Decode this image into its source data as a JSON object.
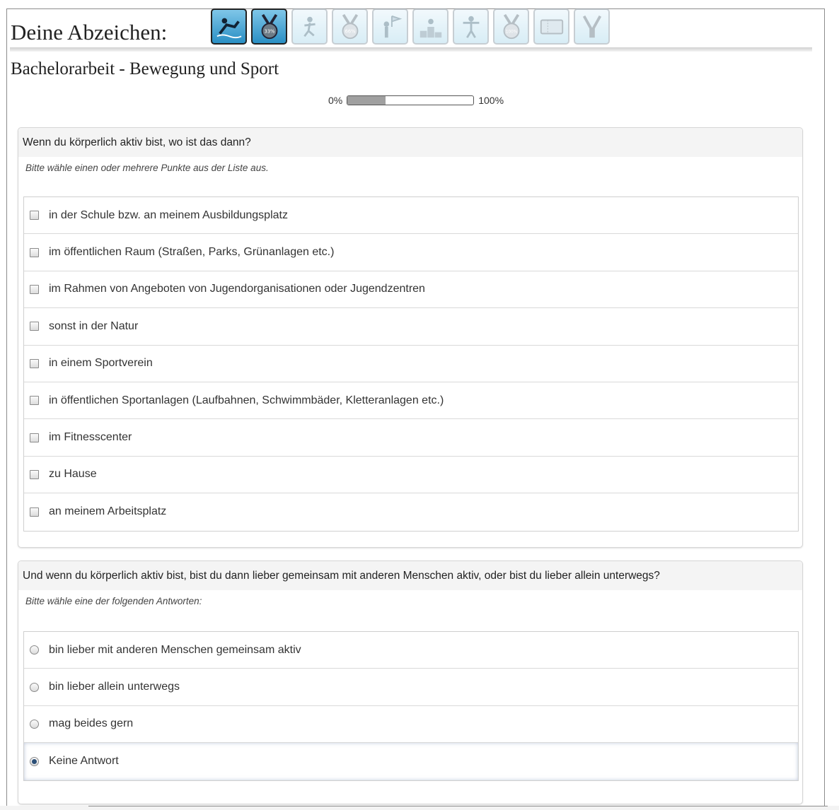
{
  "header": {
    "badges_title": "Deine Abzeichen:",
    "badges": [
      {
        "icon": "swimmer-icon",
        "earned": true
      },
      {
        "icon": "medal-33-icon",
        "earned": true
      },
      {
        "icon": "runner-icon",
        "earned": false
      },
      {
        "icon": "medal-66-icon",
        "earned": false
      },
      {
        "icon": "flag-runner-icon",
        "earned": false
      },
      {
        "icon": "podium-icon",
        "earned": false
      },
      {
        "icon": "finish-line-icon",
        "earned": false
      },
      {
        "icon": "medal-100-icon",
        "earned": false
      },
      {
        "icon": "ticket-icon",
        "earned": false
      },
      {
        "icon": "victory-icon",
        "earned": false
      }
    ]
  },
  "survey": {
    "title": "Bachelorarbeit - Bewegung und Sport",
    "progress": {
      "min_label": "0%",
      "max_label": "100%",
      "value": 0.3
    }
  },
  "question1": {
    "text": "Wenn du körperlich aktiv bist, wo ist das dann?",
    "help": "Bitte wähle einen oder mehrere Punkte aus der Liste aus.",
    "options": [
      "in der Schule bzw. an meinem Ausbildungsplatz",
      "im öffentlichen Raum (Straßen, Parks, Grünanlagen etc.)",
      "im Rahmen von Angeboten von Jugendorganisationen oder Jugendzentren",
      "sonst in der Natur",
      "in einem Sportverein",
      "in öffentlichen Sportanlagen (Laufbahnen, Schwimmbäder, Kletteranlagen etc.)",
      "im Fitnesscenter",
      "zu Hause",
      "an meinem Arbeitsplatz"
    ]
  },
  "question2": {
    "text": "Und wenn du körperlich aktiv bist, bist du dann lieber gemeinsam mit anderen Menschen aktiv, oder bist du lieber allein unterwegs?",
    "help": "Bitte wähle eine der folgenden Antworten:",
    "options": [
      "bin lieber mit anderen Menschen gemeinsam aktiv",
      "bin lieber allein unterwegs",
      "mag beides gern",
      "Keine Antwort"
    ],
    "selected_index": 3
  }
}
